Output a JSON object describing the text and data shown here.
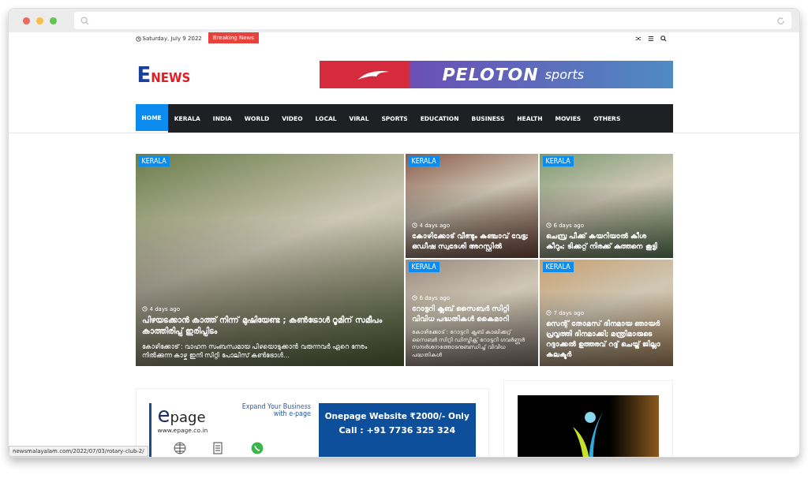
{
  "topbar": {
    "date": "Saturday, July 9 2022",
    "breaking": "Breaking News"
  },
  "logo": {
    "letter": "E",
    "word": "NEWS"
  },
  "banner": {
    "brand": "PELOTON",
    "suffix": "sports"
  },
  "nav": [
    {
      "label": "HOME",
      "selected": true
    },
    {
      "label": "KERALA",
      "selected": false
    },
    {
      "label": "INDIA",
      "selected": false
    },
    {
      "label": "WORLD",
      "selected": false
    },
    {
      "label": "VIDEO",
      "selected": false
    },
    {
      "label": "LOCAL",
      "selected": false
    },
    {
      "label": "VIRAL",
      "selected": false
    },
    {
      "label": "SPORTS",
      "selected": false
    },
    {
      "label": "EDUCATION",
      "selected": false
    },
    {
      "label": "BUSINESS",
      "selected": false
    },
    {
      "label": "HEALTH",
      "selected": false
    },
    {
      "label": "MOVIES",
      "selected": false
    },
    {
      "label": "OTHERS",
      "selected": false
    }
  ],
  "featured": {
    "tag": "KERALA",
    "time": "4 days ago",
    "title": "പിഴയടക്കാൻ കാത്ത് നിന്ന് മുഷിയേണ്ട ; കൺട്രോൾ റൂമിന് സമീപം കാത്തിരിപ്പ് ഇരിപ്പിടം",
    "excerpt": "കോഴിക്കോട് : വാഹന സംബന്ധമായ പിഴയൊടുക്കാൻ വരുന്നവർ ഏറെ നേരം നിൽക്കുന്ന കാഴ്ച ഇനി സിറ്റി പോലീസ് കൺട്രോൾ..."
  },
  "cards": [
    {
      "tag": "KERALA",
      "time": "4 days ago",
      "title": "കോഴിക്കോട് വീണ്ടും കഞ്ചാവ് വേട്ട; ഒഡീഷ സ്വദേശി അറസ്റ്റിൽ"
    },
    {
      "tag": "KERALA",
      "time": "6 days ago",
      "title": "ചെമ്പ്ര പീക്ക് കയറിയാൽ കീശ കീറും; ടിക്കറ്റ് നിരക്ക് കുത്തനെ കൂട്ടി"
    },
    {
      "tag": "KERALA",
      "time": "6 days ago",
      "title": "റോട്ടറി ക്ലബ് സൈബർ സിറ്റി വിവിധ പദ്ധതികൾ കൈമാറി",
      "excerpt": "കോഴിക്കോട് : റോട്ടറി ക്ലബ് കാലിക്കറ്റ് സൈബർ സിറ്റി ഡിസ്ട്രിക്റ്റ് റോട്ടറി ഗവർണ്ണർ സന്ദർശനത്തോടനുബന്ധിച്ച് വിവിധ പദ്ധതികൾ"
    },
    {
      "tag": "KERALA",
      "time": "7 days ago",
      "title": "സെന്റ് തോമസ് ദിനമായ ഞായർ പ്രവൃത്തി ദിനമാക്കി; മന്ത്രിമാരുടെ റദ്ദാക്കൽ ഉത്തരവ് റദ്ദ് ചെയ്ത് ജില്ലാ കലക്ടർ"
    }
  ],
  "ad": {
    "brand": "page",
    "brand_letter": "e",
    "site": "www.epage.co.in",
    "tagline": "Expand Your Business with e-page",
    "offer": "Onepage Website ₹2000/- Only",
    "phone": "Call : +91 7736 325 324"
  },
  "status_bar": "newsmalayalam.com/2022/07/03/rotary-club-2/"
}
